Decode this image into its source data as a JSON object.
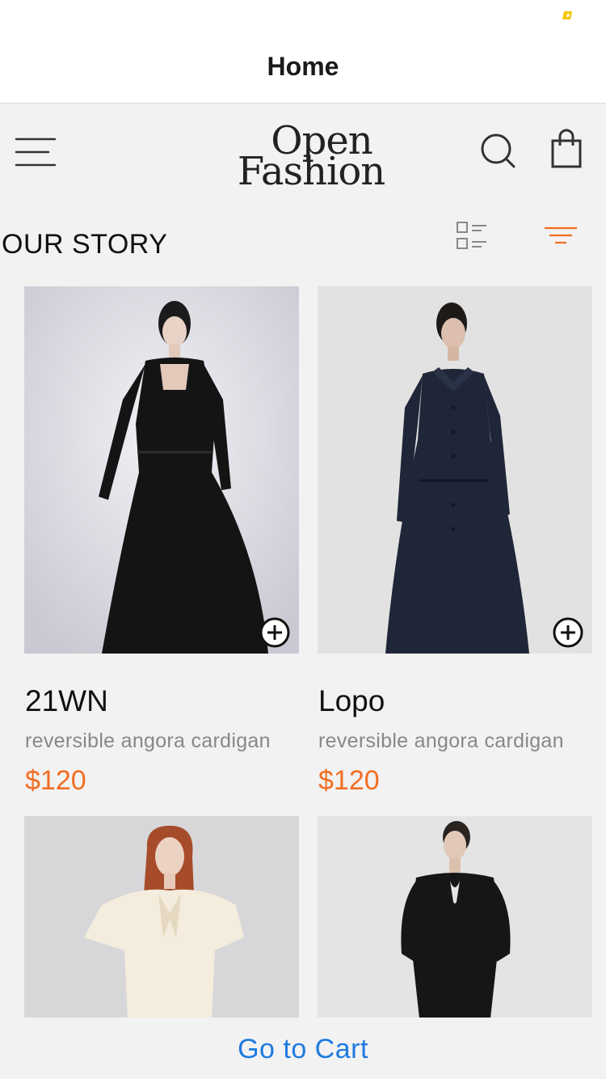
{
  "nav": {
    "title": "Home"
  },
  "header": {
    "logo_line1": "Open",
    "logo_line2": "Fashion",
    "menu_icon": "menu-icon",
    "search_icon": "search-icon",
    "bag_icon": "shopping-bag-icon"
  },
  "section": {
    "title": "OUR STORY",
    "view_icon": "grid-list-icon",
    "filter_icon": "filter-icon"
  },
  "products": [
    {
      "name": "21WN",
      "description": "reversible angora cardigan",
      "price": "$120",
      "image": "woman-in-black-square-neck-dress"
    },
    {
      "name": "Lopo",
      "description": "reversible angora cardigan",
      "price": "$120",
      "image": "woman-in-navy-collared-dress"
    },
    {
      "name": "",
      "description": "",
      "price": "",
      "image": "woman-in-cream-bow-blouse"
    },
    {
      "name": "",
      "description": "",
      "price": "",
      "image": "woman-in-black-keyhole-dress"
    }
  ],
  "footer": {
    "cart_label": "Go to Cart"
  },
  "colors": {
    "accent": "#f26e22",
    "link": "#1f7ae0",
    "background": "#f2f2f2"
  }
}
